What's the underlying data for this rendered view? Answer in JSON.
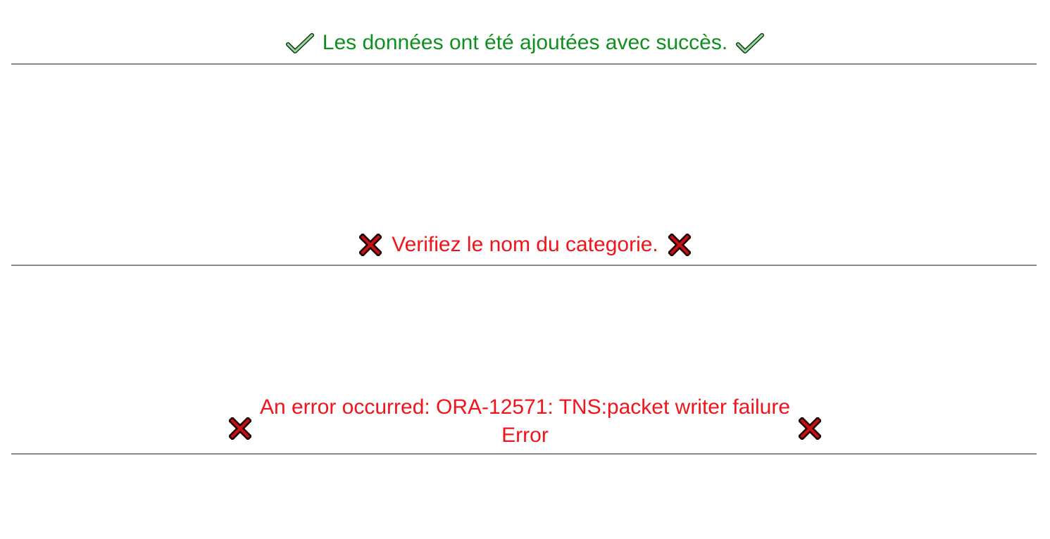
{
  "colors": {
    "success": "#0e8f1e",
    "error": "#f3141b",
    "rule": "#8a8a8a"
  },
  "messages": [
    {
      "type": "success",
      "icon": "check-icon",
      "text": "Les données ont été ajoutées avec succès."
    },
    {
      "type": "error",
      "icon": "cross-icon",
      "text": "Verifiez le nom du categorie."
    },
    {
      "type": "error",
      "icon": "cross-icon",
      "line1": "An error occurred: ORA-12571: TNS:packet writer failure",
      "line2": "Error"
    }
  ]
}
